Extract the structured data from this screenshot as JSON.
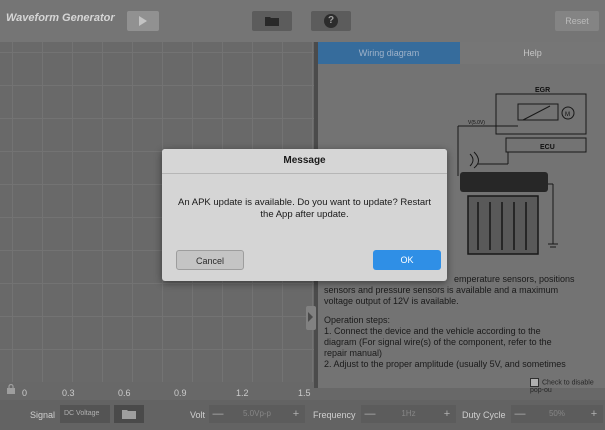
{
  "app": {
    "title": "Waveform Generator",
    "reset_label": "Reset"
  },
  "toolbar": {
    "play_icon": "play-icon",
    "folder_icon": "folder-icon",
    "help_icon": "help-icon",
    "help_glyph": "?"
  },
  "graph": {
    "x_ticks": [
      "0",
      "0.3",
      "0.6",
      "0.9",
      "1.2",
      "1.5"
    ]
  },
  "right_panel": {
    "tabs": [
      {
        "label": "Wiring diagram",
        "active": true
      },
      {
        "label": "Help",
        "active": false
      }
    ],
    "diagram": {
      "egr_label": "EGR",
      "motor_label": "M",
      "ecu_label": "ECU",
      "vref_label": "V(5.0V)"
    },
    "help_lines": [
      "emperature sensors, positions",
      "sensors and pressure sensors is available and a maximum",
      "voltage output of 12V is available.",
      "",
      "Operation steps:",
      " 1. Connect the device and the vehicle according to the",
      "diagram (For signal wire(s) of the component, refer to the",
      "repair manual)",
      " 2. Adjust to the proper amplitude (usually 5V, and sometimes"
    ],
    "disable_popup_label": "Check to disable pop-ou"
  },
  "bottom_bar": {
    "signal_label": "Signal",
    "signal_value": "DC Voltage",
    "volt_label": "Volt",
    "volt_value": "5.0Vp-p",
    "frequency_label": "Frequency",
    "frequency_value": "1Hz",
    "duty_cycle_label": "Duty Cycle",
    "duty_cycle_value": "50%",
    "minus": "—",
    "plus": "+"
  },
  "dialog": {
    "title": "Message",
    "message": "An APK update is available. Do you want to update? Restart the App after update.",
    "cancel_label": "Cancel",
    "ok_label": "OK"
  },
  "colors": {
    "accent": "#2f8fe6",
    "tab_active": "#3a73a6"
  }
}
